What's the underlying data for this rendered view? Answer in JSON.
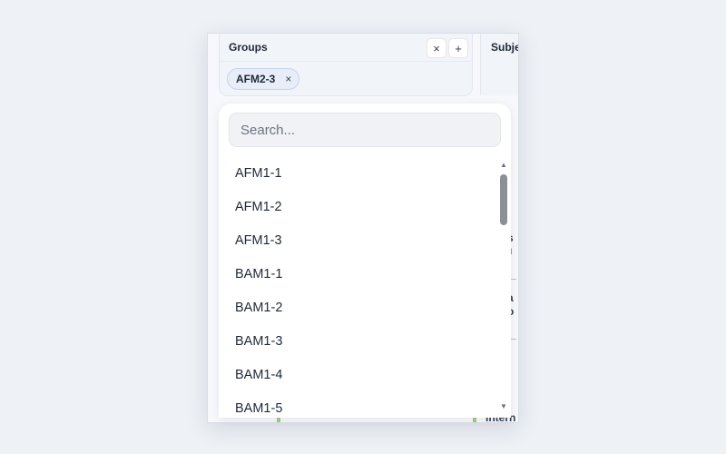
{
  "groups": {
    "title": "Groups",
    "clear_icon": "close-icon",
    "add_icon": "plus-icon",
    "clear_glyph": "×",
    "add_glyph": "+",
    "selected": [
      {
        "label": "AFM2-3",
        "remove_glyph": "×"
      }
    ]
  },
  "subjects": {
    "title": "Subje"
  },
  "underlay": {
    "fragments": [
      "s",
      "u",
      "a",
      "o",
      "Intern"
    ]
  },
  "dropdown": {
    "search_placeholder": "Search...",
    "search_value": "",
    "options": [
      "AFM1-1",
      "AFM1-2",
      "AFM1-3",
      "BAM1-1",
      "BAM1-2",
      "BAM1-3",
      "BAM1-4",
      "BAM1-5"
    ],
    "scroll_up_glyph": "▲",
    "scroll_down_glyph": "▼"
  }
}
